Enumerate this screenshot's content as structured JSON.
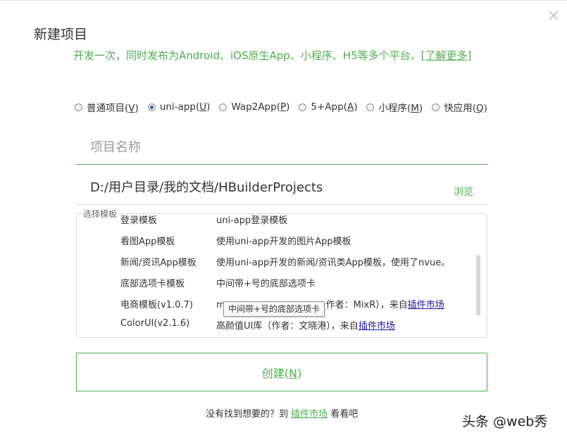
{
  "dialog": {
    "title": "新建项目",
    "subtitle": "开发一次，同时发布为Android、iOS原生App、小程序、H5等多个平台。",
    "learn_more": "[了解更多]"
  },
  "project_types": [
    {
      "label": "普通项目(",
      "key": "V",
      "checked": false
    },
    {
      "label": "uni-app(",
      "key": "U",
      "checked": true
    },
    {
      "label": "Wap2App(",
      "key": "P",
      "checked": false
    },
    {
      "label": "5+App(",
      "key": "A",
      "checked": false
    },
    {
      "label": "小程序(",
      "key": "M",
      "checked": false
    },
    {
      "label": "快应用(",
      "key": "Q",
      "checked": false
    }
  ],
  "name_field": {
    "placeholder": "项目名称",
    "value": ""
  },
  "path": {
    "value": "D:/用户目录/我的文档/HBuilderProjects",
    "browse_label": "浏览"
  },
  "templates": {
    "legend": "选择模板",
    "rows": [
      {
        "name": "登录模板",
        "desc": "uni-app登录模板"
      },
      {
        "name": "看图App模板",
        "desc": "使用uni-app开发的图片App模板"
      },
      {
        "name": "新闻/资讯App模板",
        "desc": "使用uni-app开发的新闻/资讯类App模板，使用了nvue。"
      },
      {
        "name": "底部选项卡模板",
        "desc": "中间带+号的底部选项卡"
      },
      {
        "name": "电商模板(v1.0.7)",
        "desc": "m",
        "desc_mid": "作者：MixR），来自",
        "desc_link": "插件市场"
      },
      {
        "name": "ColorUI(v2.1.6)",
        "desc": "高颜值UI库（作者：文晓港），来自",
        "desc_link": "插件市场"
      }
    ],
    "tooltip": "中间带+号的底部选项卡"
  },
  "create_button": {
    "label": "创建(",
    "key": "N"
  },
  "footer": {
    "prefix": "没有找到想要的？到 ",
    "link": "插件市场",
    "suffix": " 看看吧"
  },
  "watermark": "头条 @web秀",
  "colors": {
    "accent": "#4cae4c",
    "link": "#1a1aa6",
    "radio_checked": "#2b5fb0"
  }
}
